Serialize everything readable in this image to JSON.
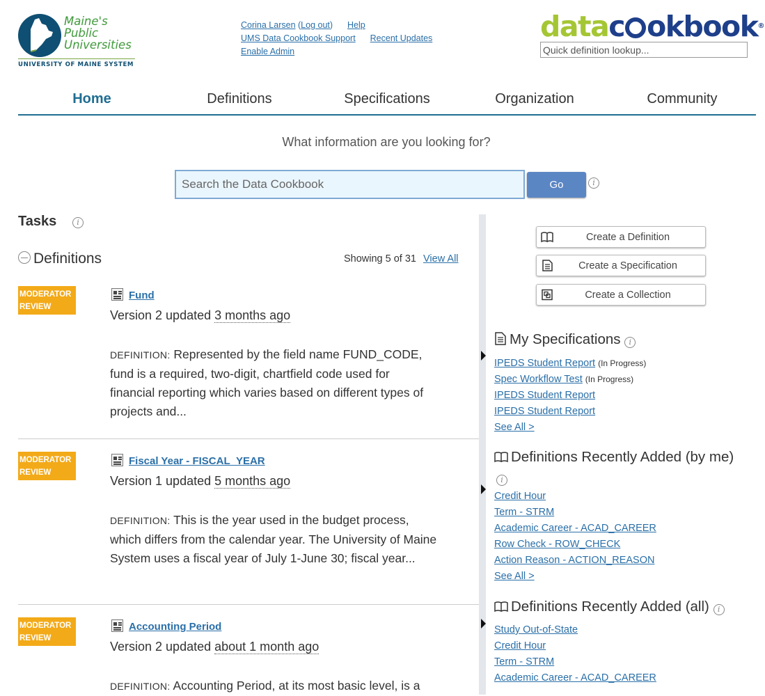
{
  "header": {
    "logo": {
      "line1": "Maine's",
      "line2": "Public",
      "line3": "Universities",
      "subtitle": "UNIVERSITY OF MAINE SYSTEM"
    },
    "user": {
      "name": "Corina Larsen",
      "logout": "Log out",
      "help": "Help",
      "support": "UMS Data Cookbook Support",
      "recent": "Recent Updates",
      "admin": "Enable Admin"
    },
    "brand": {
      "part1": "data",
      "part2a": "c",
      "part2b": "okbook",
      "reg": "®"
    },
    "quick_lookup_placeholder": "Quick definition lookup..."
  },
  "nav": [
    "Home",
    "Definitions",
    "Specifications",
    "Organization",
    "Community"
  ],
  "search": {
    "prompt": "What information are you looking for?",
    "placeholder": "Search the Data Cookbook",
    "go": "Go"
  },
  "tasks": {
    "title": "Tasks",
    "definitions_heading": "Definitions",
    "showing": "Showing 5 of 31",
    "view_all": "View All",
    "items": [
      {
        "badge1": "MODERATOR",
        "badge2": "REVIEW",
        "title": "Fund",
        "version": "Version 2 updated ",
        "ago": "3 months ago",
        "label": "DEFINITION:",
        "desc": "Represented by the field name FUND_CODE, fund is a required, two-digit, chartfield code used for financial reporting which varies based on different types of projects and..."
      },
      {
        "badge1": "MODERATOR",
        "badge2": "REVIEW",
        "title": "Fiscal Year - FISCAL_YEAR",
        "version": "Version 1 updated ",
        "ago": "5 months ago",
        "label": "DEFINITION:",
        "desc": "This is the year used in the budget process, which differs from the calendar year. The University of Maine System uses a fiscal year of July 1-June 30; fiscal year..."
      },
      {
        "badge1": "MODERATOR",
        "badge2": "REVIEW",
        "title": "Accounting Period",
        "version": "Version 2 updated ",
        "ago": "about 1 month ago",
        "label": "DEFINITION:",
        "desc": "Accounting Period, at its most basic level, is a"
      }
    ]
  },
  "actions": {
    "create_definition": "Create a Definition",
    "create_specification": "Create a Specification",
    "create_collection": "Create a Collection"
  },
  "my_specs": {
    "heading": "My Specifications",
    "items": [
      {
        "label": "IPEDS Student Report",
        "status": "(In Progress)"
      },
      {
        "label": "Spec Workflow Test",
        "status": "(In Progress)"
      },
      {
        "label": "IPEDS Student Report",
        "status": ""
      },
      {
        "label": "IPEDS Student Report",
        "status": ""
      }
    ],
    "see_all": "See All >"
  },
  "recent_by_me": {
    "heading": "Definitions Recently Added (by me)",
    "items": [
      "Credit Hour",
      "Term - STRM",
      "Academic Career - ACAD_CAREER",
      "Row Check - ROW_CHECK",
      "Action Reason - ACTION_REASON"
    ],
    "see_all": "See All >"
  },
  "recent_all": {
    "heading": "Definitions Recently Added (all)",
    "items": [
      "Study Out-of-State",
      "Credit Hour",
      "Term - STRM",
      "Academic Career - ACAD_CAREER"
    ]
  },
  "colors": {
    "nav_accent": "#1f6d92",
    "badge": "#f3aa18",
    "link": "#2a6fa8",
    "go_button": "#5b86c4",
    "brand_green": "#a5c634",
    "brand_blue": "#1e3f8a"
  }
}
